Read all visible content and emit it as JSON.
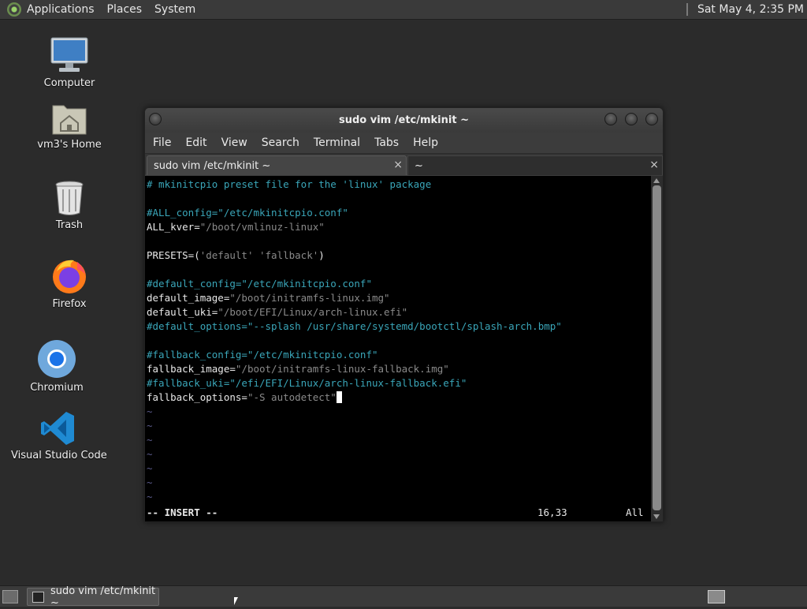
{
  "top_panel": {
    "menus": [
      "Applications",
      "Places",
      "System"
    ],
    "clock": "Sat May 4, 2:35 PM"
  },
  "desktop": {
    "icons": [
      {
        "label": "Computer",
        "icon": "computer-icon"
      },
      {
        "label": "vm3's Home",
        "icon": "home-folder-icon"
      },
      {
        "label": "Trash",
        "icon": "trash-icon"
      },
      {
        "label": "Firefox",
        "icon": "firefox-icon"
      },
      {
        "label": "Chromium",
        "icon": "chromium-icon"
      },
      {
        "label": "Visual Studio Code",
        "icon": "vscode-icon"
      }
    ]
  },
  "terminal": {
    "title": "sudo vim /etc/mkinit ~",
    "menus": [
      "File",
      "Edit",
      "View",
      "Search",
      "Terminal",
      "Tabs",
      "Help"
    ],
    "tabs": [
      {
        "label": "sudo vim /etc/mkinit ~",
        "close": "×"
      },
      {
        "label": "~",
        "close": "×"
      }
    ],
    "lines": [
      [
        {
          "t": "# mkinitcpio preset file for the 'linux' package",
          "c": "comment"
        }
      ],
      [],
      [
        {
          "t": "#ALL_config=\"/etc/mkinitcpio.conf\"",
          "c": "comment"
        }
      ],
      [
        {
          "t": "ALL_kver=",
          "c": "plain"
        },
        {
          "t": "\"/boot/vmlinuz-linux\"",
          "c": "str"
        }
      ],
      [],
      [
        {
          "t": "PRESETS=(",
          "c": "plain"
        },
        {
          "t": "'default'",
          "c": "str"
        },
        {
          "t": " ",
          "c": "plain"
        },
        {
          "t": "'fallback'",
          "c": "str"
        },
        {
          "t": ")",
          "c": "plain"
        }
      ],
      [],
      [
        {
          "t": "#default_config=\"/etc/mkinitcpio.conf\"",
          "c": "comment"
        }
      ],
      [
        {
          "t": "default_image=",
          "c": "plain"
        },
        {
          "t": "\"/boot/initramfs-linux.img\"",
          "c": "str"
        }
      ],
      [
        {
          "t": "default_uki=",
          "c": "plain"
        },
        {
          "t": "\"/boot/EFI/Linux/arch-linux.efi\"",
          "c": "str"
        }
      ],
      [
        {
          "t": "#default_options=\"--splash /usr/share/systemd/bootctl/splash-arch.bmp\"",
          "c": "comment"
        }
      ],
      [],
      [
        {
          "t": "#fallback_config=\"/etc/mkinitcpio.conf\"",
          "c": "comment"
        }
      ],
      [
        {
          "t": "fallback_image=",
          "c": "plain"
        },
        {
          "t": "\"/boot/initramfs-linux-fallback.img\"",
          "c": "str"
        }
      ],
      [
        {
          "t": "#fallback_uki=\"/efi/EFI/Linux/arch-linux-fallback.efi\"",
          "c": "comment"
        }
      ],
      [
        {
          "t": "fallback_options=",
          "c": "plain"
        },
        {
          "t": "\"-S autodetect\"",
          "c": "str"
        },
        {
          "t": "",
          "c": "cursor"
        }
      ],
      [
        {
          "t": "~",
          "c": "tilde"
        }
      ],
      [
        {
          "t": "~",
          "c": "tilde"
        }
      ],
      [
        {
          "t": "~",
          "c": "tilde"
        }
      ],
      [
        {
          "t": "~",
          "c": "tilde"
        }
      ],
      [
        {
          "t": "~",
          "c": "tilde"
        }
      ],
      [
        {
          "t": "~",
          "c": "tilde"
        }
      ],
      [
        {
          "t": "~",
          "c": "tilde"
        }
      ]
    ],
    "status_mode": "-- INSERT --",
    "status_pos": "16,33",
    "status_pct": "All"
  },
  "bottom_panel": {
    "task_label": "sudo vim /etc/mkinit ~"
  }
}
